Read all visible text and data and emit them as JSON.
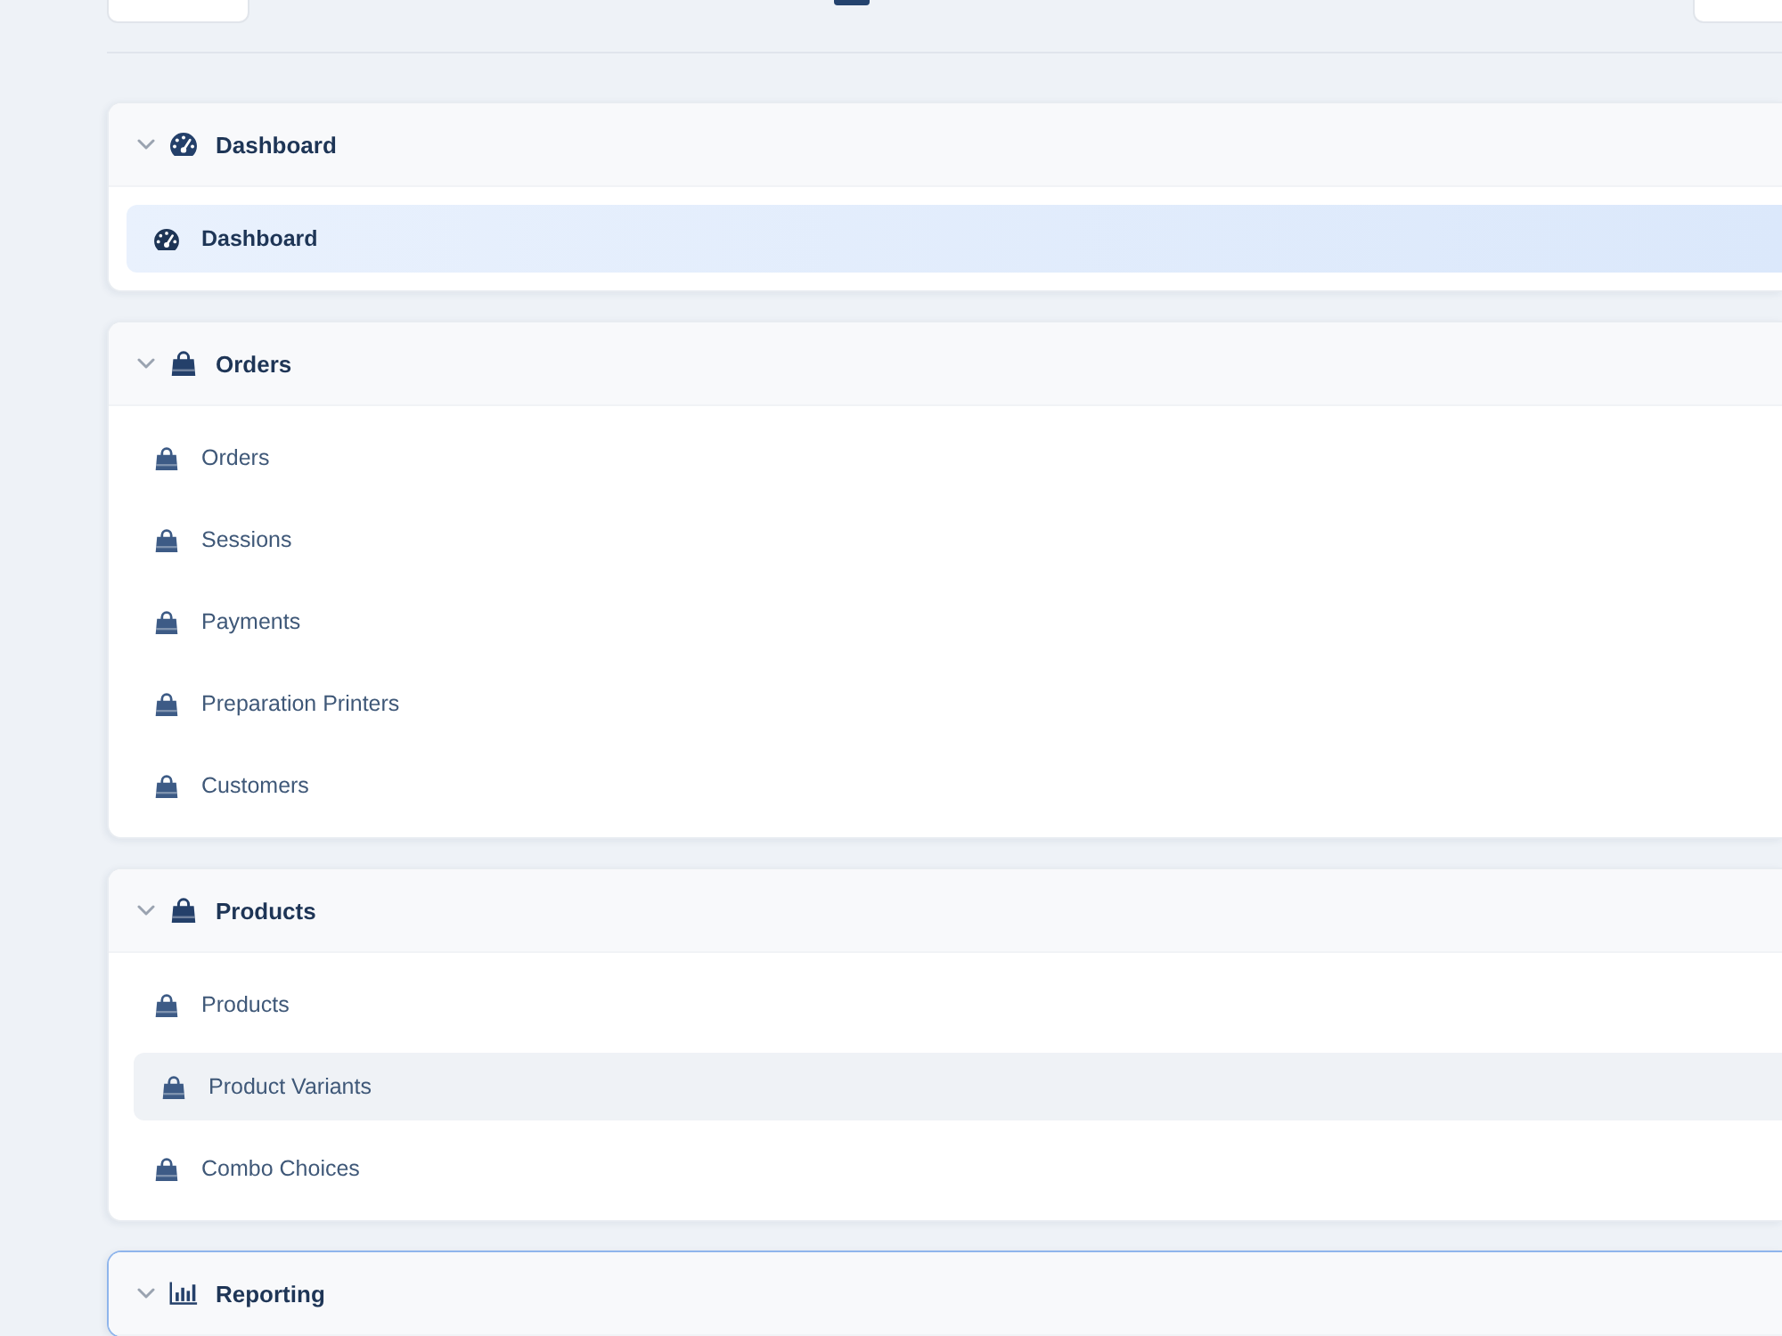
{
  "sections": [
    {
      "kind": "gauge",
      "title": "Dashboard",
      "expanded": true,
      "focused": false,
      "items": [
        {
          "label": "Dashboard",
          "selected": true,
          "hovered": false
        }
      ]
    },
    {
      "kind": "bag",
      "title": "Orders",
      "expanded": true,
      "focused": false,
      "items": [
        {
          "label": "Orders",
          "selected": false,
          "hovered": false
        },
        {
          "label": "Sessions",
          "selected": false,
          "hovered": false
        },
        {
          "label": "Payments",
          "selected": false,
          "hovered": false
        },
        {
          "label": "Preparation Printers",
          "selected": false,
          "hovered": false
        },
        {
          "label": "Customers",
          "selected": false,
          "hovered": false
        }
      ]
    },
    {
      "kind": "bag",
      "title": "Products",
      "expanded": true,
      "focused": false,
      "items": [
        {
          "label": "Products",
          "selected": false,
          "hovered": false
        },
        {
          "label": "Product Variants",
          "selected": false,
          "hovered": true
        },
        {
          "label": "Combo Choices",
          "selected": false,
          "hovered": false
        }
      ]
    },
    {
      "kind": "chart",
      "title": "Reporting",
      "expanded": true,
      "focused": true
    }
  ]
}
